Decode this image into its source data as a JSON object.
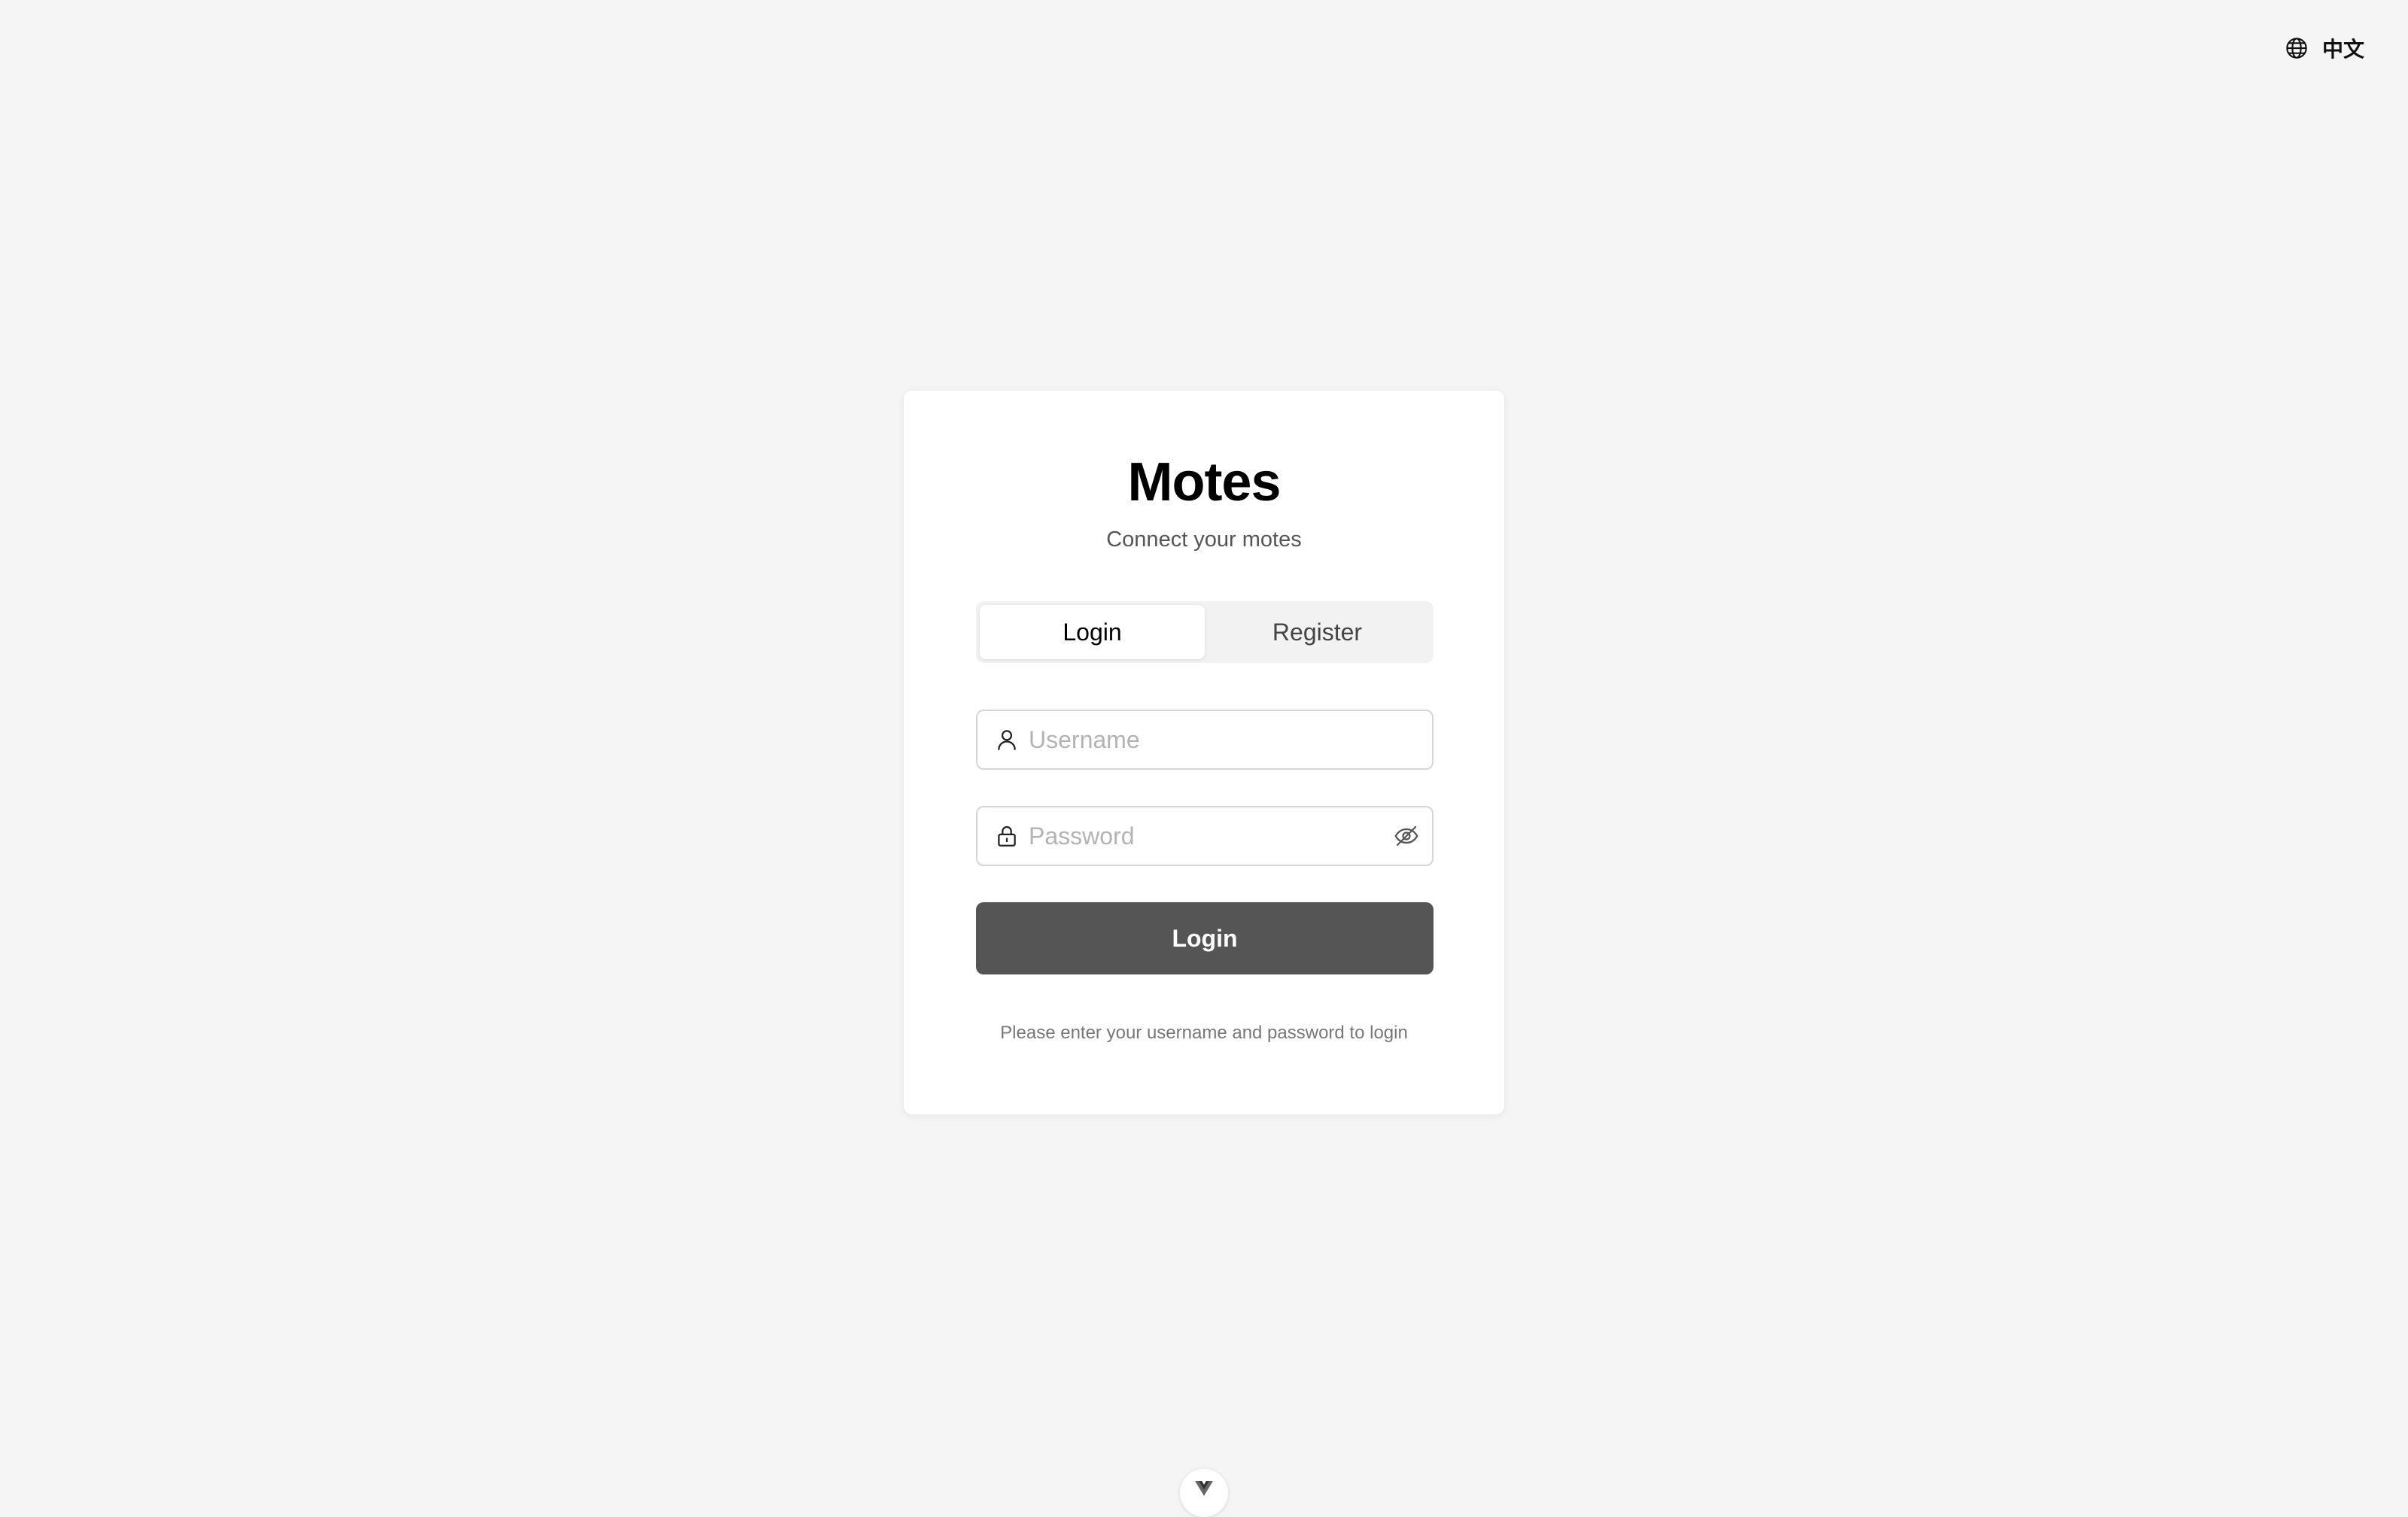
{
  "language_switch": {
    "icon": "globe-icon",
    "label": "中文"
  },
  "brand": {
    "title": "Motes",
    "subtitle": "Connect your motes"
  },
  "tabs": [
    {
      "label": "Login",
      "active": true
    },
    {
      "label": "Register",
      "active": false
    }
  ],
  "form": {
    "username": {
      "icon": "user-icon",
      "value": "",
      "placeholder": "Username"
    },
    "password": {
      "icon": "lock-icon",
      "value": "",
      "placeholder": "Password",
      "toggle_icon": "eye-off-icon"
    },
    "submit_label": "Login",
    "hint": "Please enter your username and password to login"
  },
  "devtools": {
    "icon": "vue-logo-icon"
  },
  "colors": {
    "background": "#f5f5f5",
    "card": "#ffffff",
    "primary_button": "#555555",
    "placeholder": "#b3b3b3"
  }
}
